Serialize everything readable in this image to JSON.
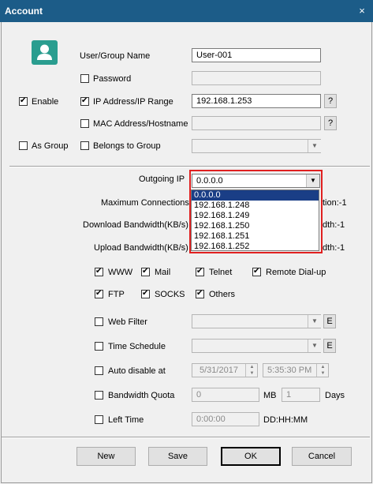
{
  "window": {
    "title": "Account",
    "close_glyph": "×"
  },
  "user_icon": {
    "icon": "user-icon",
    "color": "#2a9d8f"
  },
  "fields": {
    "user_group_name": {
      "label": "User/Group Name",
      "value": "User-001"
    },
    "password": {
      "label": "Password",
      "checked": false,
      "value": ""
    },
    "enable": {
      "label": "Enable",
      "checked": true
    },
    "ip_range": {
      "label": "IP Address/IP Range",
      "checked": true,
      "value": "192.168.1.253",
      "help": "?"
    },
    "mac_hostname": {
      "label": "MAC Address/Hostname",
      "checked": false,
      "value": "",
      "help": "?"
    },
    "as_group": {
      "label": "As Group",
      "checked": false
    },
    "belongs_to_group": {
      "label": "Belongs to Group",
      "checked": false,
      "value": ""
    }
  },
  "outgoing_ip": {
    "label": "Outgoing IP",
    "value": "0.0.0.0",
    "options": [
      "0.0.0.0",
      "192.168.1.248",
      "192.168.1.249",
      "192.168.1.250",
      "192.168.1.251",
      "192.168.1.252"
    ],
    "selected_index": 0,
    "highlight_color": "#e02020"
  },
  "limits": {
    "max_connections": {
      "label": "Maximum Connections",
      "suffix": "tion:-1"
    },
    "download_bw": {
      "label": "Download Bandwidth(KB/s)",
      "suffix": "dth:-1"
    },
    "upload_bw": {
      "label": "Upload Bandwidth(KB/s)",
      "suffix": "dth:-1"
    }
  },
  "protocols": [
    {
      "label": "WWW",
      "checked": true
    },
    {
      "label": "Mail",
      "checked": true
    },
    {
      "label": "Telnet",
      "checked": true
    },
    {
      "label": "Remote Dial-up",
      "checked": true
    },
    {
      "label": "FTP",
      "checked": true
    },
    {
      "label": "SOCKS",
      "checked": true
    },
    {
      "label": "Others",
      "checked": true
    }
  ],
  "filters": {
    "web_filter": {
      "label": "Web Filter",
      "checked": false,
      "edit": "E"
    },
    "time_schedule": {
      "label": "Time Schedule",
      "checked": false,
      "edit": "E"
    },
    "auto_disable": {
      "label": "Auto disable at",
      "checked": false,
      "date": "5/31/2017",
      "time": "5:35:30 PM"
    },
    "bandwidth_quota": {
      "label": "Bandwidth Quota",
      "checked": false,
      "mb_value": "0",
      "mb_unit": "MB",
      "days_value": "1",
      "days_unit": "Days"
    },
    "left_time": {
      "label": "Left Time",
      "checked": false,
      "value": "0:00:00",
      "format": "DD:HH:MM"
    }
  },
  "buttons": {
    "new": "New",
    "save": "Save",
    "ok": "OK",
    "cancel": "Cancel"
  }
}
